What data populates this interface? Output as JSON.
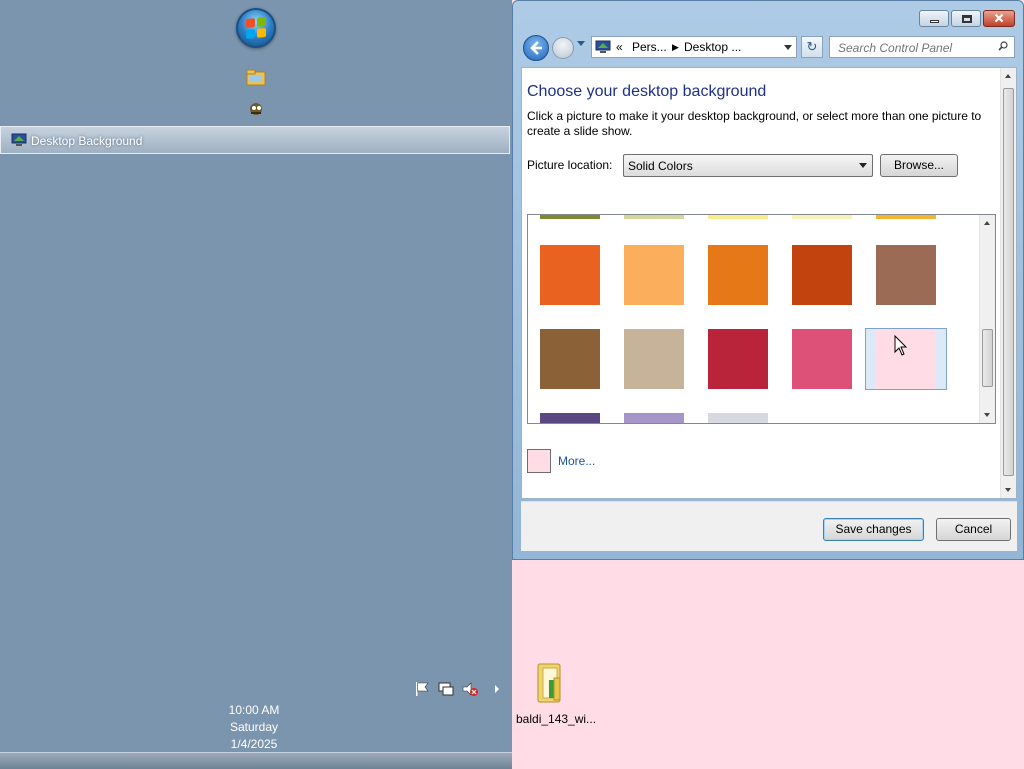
{
  "taskbar": {
    "active_task": "Desktop Background",
    "clock": {
      "time": "10:00 AM",
      "day": "Saturday",
      "date": "1/4/2025"
    }
  },
  "window": {
    "address": {
      "overflow": "«",
      "crumb1": "Pers...",
      "crumb2": "Desktop ..."
    },
    "search": {
      "placeholder": "Search Control Panel"
    },
    "title": "Choose your desktop background",
    "description": "Click a picture to make it your desktop background, or select more than one picture to create a slide show.",
    "picture_location_label": "Picture location:",
    "picture_location_value": "Solid Colors",
    "browse_label": "Browse...",
    "more_label": "More...",
    "selected_color": "#ffdce6",
    "swatches": {
      "row_top_partial": [
        "#7f8a2f",
        "#d3d89a",
        "#f6ee8e",
        "#faf3b8",
        "#f2b632"
      ],
      "row1": [
        "#ea621f",
        "#fbae5c",
        "#e77817",
        "#c2430d",
        "#9b6b55"
      ],
      "row2": [
        "#8b6238",
        "#c7b399",
        "#b9243a",
        "#dd5178",
        "#ffdce6"
      ],
      "row_bottom_partial": [
        "#5a4782",
        "#a595c8",
        "#d8d8e0"
      ]
    },
    "save_label": "Save changes",
    "cancel_label": "Cancel"
  },
  "desktop": {
    "background_color": "#ffdce6",
    "icon_label": "baldi_143_wi..."
  }
}
